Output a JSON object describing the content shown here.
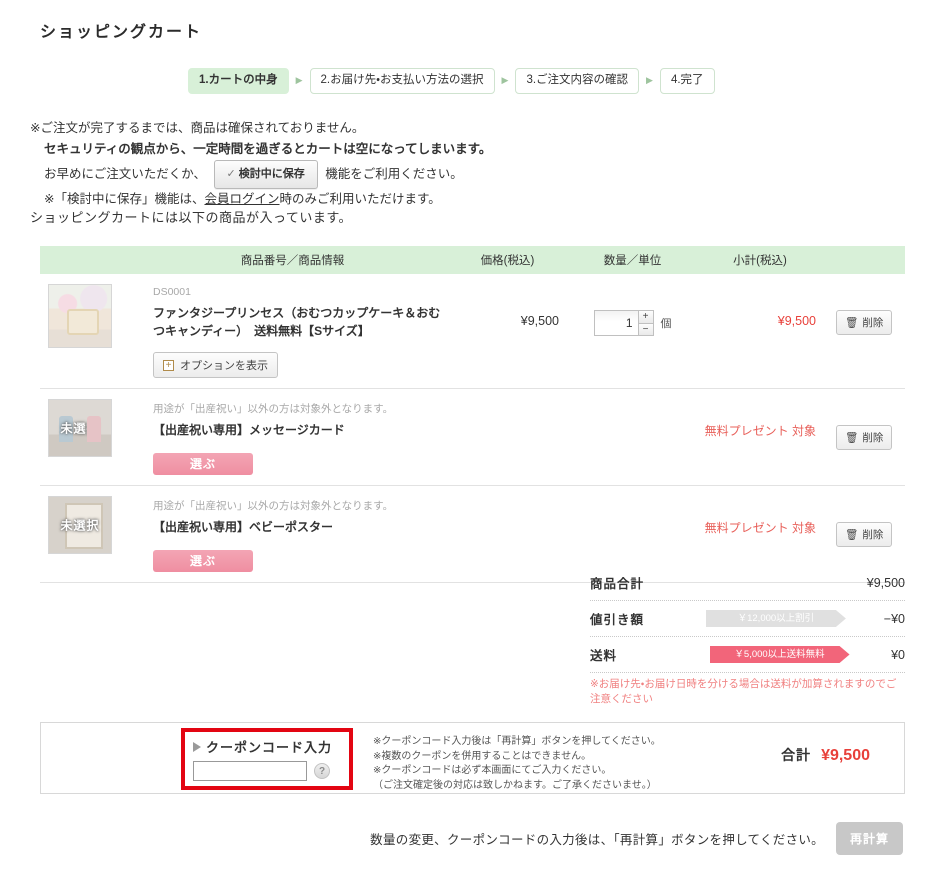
{
  "page": {
    "title": "ショッピングカート"
  },
  "steps": {
    "separator_icon": "triangle-right-icon",
    "items": [
      {
        "label": "1.カートの中身",
        "active": true
      },
      {
        "label": "2.お届け先・お支払い方法の選択",
        "active": false
      },
      {
        "label": "3.ご注文内容の確認",
        "active": false
      },
      {
        "label": "4.完了",
        "active": false
      }
    ]
  },
  "notice": {
    "line1": "※ご注文が完了するまでは、商品は確保されておりません。",
    "line2": "セキュリティの観点から、一定時間を過ぎるとカートは空になってしまいます。",
    "line3_before": "お早めにご注文いただくか、",
    "save_button_check": "✓",
    "save_button_label": "検討中に保存",
    "line3_after": "機能をご利用ください。",
    "line4_before": "※「検討中に保存」機能は、",
    "line4_link": "会員ログイン",
    "line4_after": "時のみご利用いただけます。"
  },
  "cart_intro": "ショッピングカートには以下の商品が入っています。",
  "table": {
    "headers": {
      "image": "",
      "info": "商品番号／商品情報",
      "price": "価格(税込)",
      "qty": "数量／単位",
      "subtotal": "小計(税込)",
      "delete": ""
    },
    "rows": [
      {
        "thumb_kind": "product-photo",
        "thumb_label": "",
        "sku": "DS0001",
        "note": "",
        "name": "ファンタジープリンセス（おむつカップケーキ＆おむつキャンディー）　送料無料【Sサイズ】",
        "option_button": "オプションを表示",
        "option_icon": "plus-box-icon",
        "choose_button": "",
        "price": "¥9,500",
        "qty_value": "1",
        "qty_unit": "個",
        "subtotal": "¥9,500",
        "subtotal_is_present": false,
        "delete_label": "削除",
        "delete_icon": "trash-icon"
      },
      {
        "thumb_kind": "placeholder-card",
        "thumb_label": "未選択",
        "sku": "",
        "note": "用途が「出産祝い」以外の方は対象外となります。",
        "name": "【出産祝い専用】メッセージカード",
        "option_button": "",
        "option_icon": "",
        "choose_button": "選ぶ",
        "price": "",
        "qty_value": "",
        "qty_unit": "",
        "subtotal": "無料プレゼント\n対象",
        "subtotal_is_present": true,
        "delete_label": "削除",
        "delete_icon": "trash-icon"
      },
      {
        "thumb_kind": "placeholder-poster",
        "thumb_label": "未選択",
        "sku": "",
        "note": "用途が「出産祝い」以外の方は対象外となります。",
        "name": "【出産祝い専用】ベビーポスター",
        "option_button": "",
        "option_icon": "",
        "choose_button": "選ぶ",
        "price": "",
        "qty_value": "",
        "qty_unit": "",
        "subtotal": "無料プレゼント\n対象",
        "subtotal_is_present": true,
        "delete_label": "削除",
        "delete_icon": "trash-icon"
      }
    ]
  },
  "totals": {
    "subtotal_label": "商品合計",
    "subtotal_value": "¥9,500",
    "discount_label": "値引き額",
    "discount_ribbon": "￥12,000以上割引",
    "discount_value": "−¥0",
    "shipping_label": "送料",
    "shipping_ribbon": "￥5,000以上送料無料",
    "shipping_value": "¥0",
    "shipping_note": "※お届け先・お届け日時を分ける場合は送料が加算されますのでご注意ください"
  },
  "coupon": {
    "title": "クーポンコード入力",
    "triangle_icon": "triangle-right-icon",
    "input_value": "",
    "input_placeholder": "",
    "help_icon": "question-mark-icon",
    "help_label": "?",
    "notes": [
      "※クーポンコード入力後は「再計算」ボタンを押してください。",
      "※複数のクーポンを併用することはできません。",
      "※クーポンコードは必ず本画面にてご入力ください。",
      "（ご注文確定後の対応は致しかねます。ご了承くださいませ。）"
    ],
    "grand_label": "合計",
    "grand_value": "¥9,500"
  },
  "footer": {
    "text": "数量の変更、クーポンコードの入力後は、「再計算」ボタンを押してください。",
    "recalc_button": "再計算"
  },
  "colors": {
    "accent_green": "#d8f0d8",
    "price_red": "#e8403a",
    "pink_button": "#ef8ea1",
    "coupon_border_red": "#e30512",
    "ribbon_active": "#f2657a",
    "ribbon_inactive": "#e0e0e0"
  }
}
